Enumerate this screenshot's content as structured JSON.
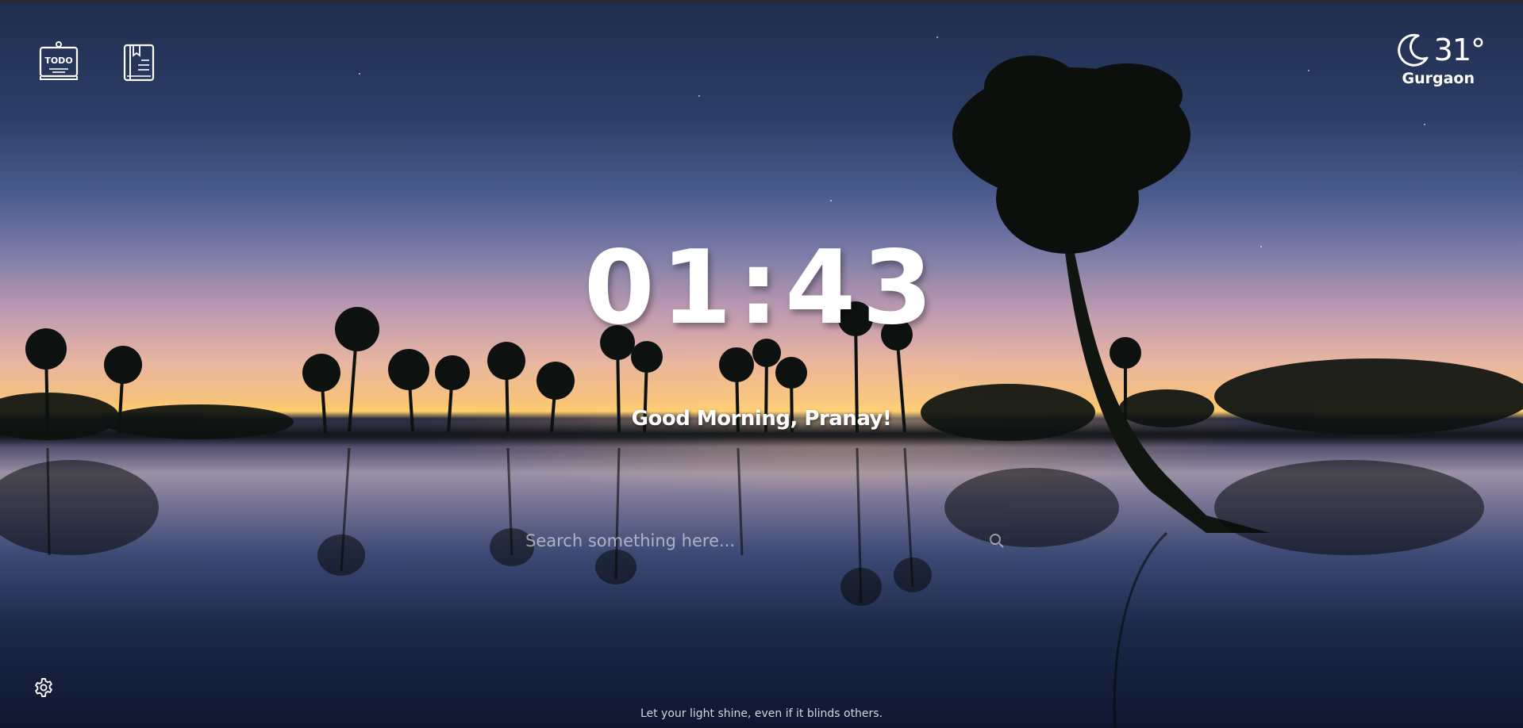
{
  "app": {
    "background_theme": "sunset-palm-lake"
  },
  "toolbar": {
    "todo_icon": "todo-note-icon",
    "notes_icon": "notebook-icon"
  },
  "weather": {
    "icon": "moon-icon",
    "temperature": "31°",
    "city": "Gurgaon"
  },
  "clock": {
    "time": "01:43"
  },
  "greeting": {
    "text": "Good Morning, Pranay!"
  },
  "search": {
    "placeholder": "Search something here...",
    "value": "",
    "icon": "search-icon"
  },
  "footer": {
    "settings_icon": "gear-icon",
    "quote": "Let your light shine, even if it blinds others."
  },
  "colors": {
    "text": "#ffffff",
    "sky_top": "#1f2d4d",
    "horizon_glow": "#ffcf6a",
    "water_bottom": "#0e1630"
  }
}
